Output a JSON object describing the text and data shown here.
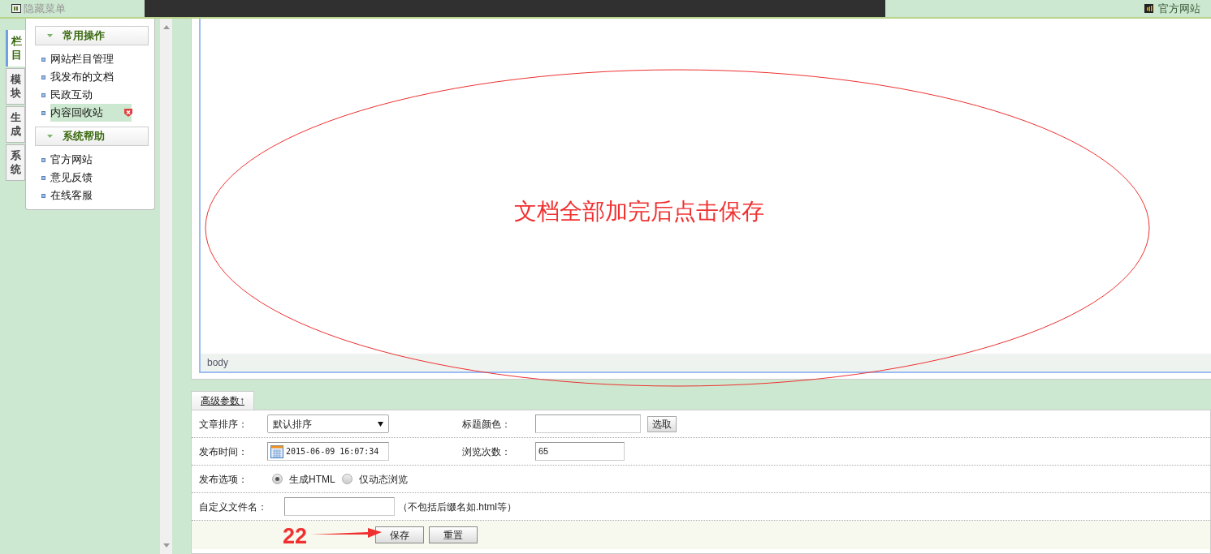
{
  "top_bar": {
    "hide_menu_label": "隐藏菜单",
    "official_site_link": "官方网站"
  },
  "side_tabs": [
    {
      "label": "栏目",
      "selected": true
    },
    {
      "label": "模块",
      "selected": false
    },
    {
      "label": "生成",
      "selected": false
    },
    {
      "label": "系统",
      "selected": false
    }
  ],
  "menu_groups": [
    {
      "title": "常用操作",
      "items": [
        {
          "label": "网站栏目管理",
          "selected": false
        },
        {
          "label": "我发布的文档",
          "selected": false
        },
        {
          "label": "民政互动",
          "selected": false
        },
        {
          "label": "内容回收站",
          "selected": true
        }
      ]
    },
    {
      "title": "系统帮助",
      "items": [
        {
          "label": "官方网站",
          "selected": false
        },
        {
          "label": "意见反馈",
          "selected": false
        },
        {
          "label": "在线客服",
          "selected": false
        }
      ]
    }
  ],
  "editor": {
    "status_path": "body"
  },
  "annotation": {
    "note": "文档全部加完后点击保存",
    "step_number": "22"
  },
  "advanced_tab": {
    "label": "高级参数↑"
  },
  "form": {
    "sort": {
      "label": "文章排序：",
      "value": "默认排序"
    },
    "title_color": {
      "label": "标题颜色：",
      "button": "选取"
    },
    "publish_time": {
      "label": "发布时间：",
      "value": "2015-06-09 16:07:34"
    },
    "views": {
      "label": "浏览次数：",
      "value": "65"
    },
    "publish_option": {
      "label": "发布选项：",
      "options": [
        {
          "label": "生成HTML",
          "selected": true
        },
        {
          "label": "仅动态浏览",
          "selected": false
        }
      ]
    },
    "filename": {
      "label": "自定义文件名：",
      "hint": "（不包括后缀名如.html等）"
    },
    "buttons": [
      "保存",
      "重置"
    ]
  }
}
